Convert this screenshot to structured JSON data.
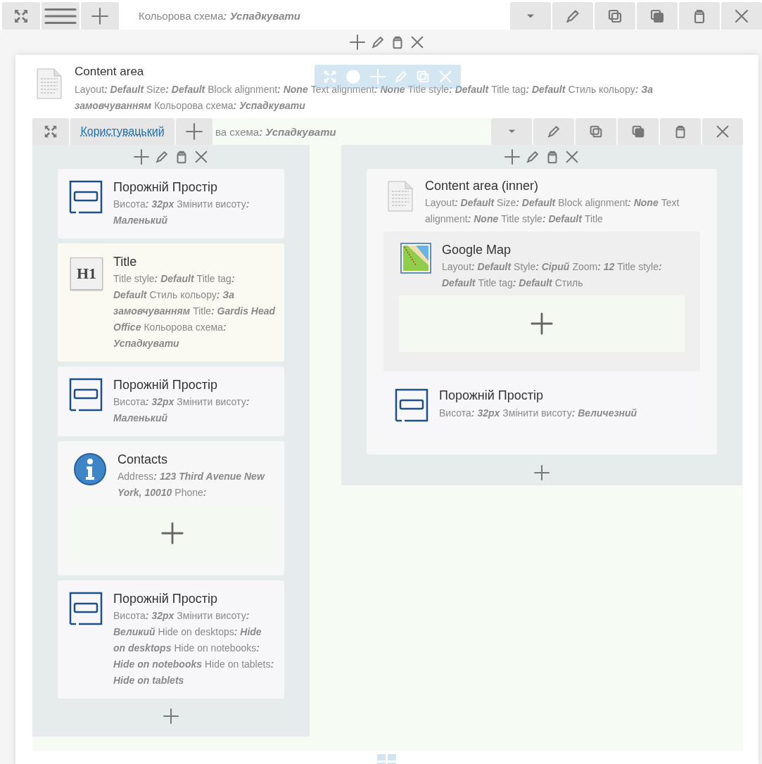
{
  "top_bar": {
    "scheme": {
      "label": "Кольорова схема",
      "value": ": Успадкувати"
    }
  },
  "content_area": {
    "title": "Content area",
    "meta": [
      {
        "label": "Layout",
        "value": ": Default"
      },
      {
        "label": "Size",
        "value": ": Default"
      },
      {
        "label": "Block alignment",
        "value": ": None"
      },
      {
        "label": "Text alignment",
        "value": ": None"
      },
      {
        "label": "Title style",
        "value": ": Default"
      },
      {
        "label": "Title tag",
        "value": ": Default"
      },
      {
        "label": "Стиль кольору",
        "value": ": За замовчуванням"
      },
      {
        "label": "Кольорова схема",
        "value": ": Успадкувати"
      }
    ],
    "row": {
      "tab": "Користувацький",
      "scheme": {
        "label": "ва схема",
        "value": ": Успадкувати"
      },
      "columns": [
        {
          "blocks": [
            {
              "kind": "spacer",
              "title": "Порожній Простір",
              "meta": [
                {
                  "label": "Висота",
                  "value": ": 32px"
                },
                {
                  "label": "Змінити висоту",
                  "value": ": Маленький"
                }
              ]
            },
            {
              "kind": "title",
              "icon_text": "H1",
              "title": "Title",
              "meta": [
                {
                  "label": "Title style",
                  "value": ": Default"
                },
                {
                  "label": "Title tag",
                  "value": ": Default"
                },
                {
                  "label": "Стиль кольору",
                  "value": ": За замовчуванням"
                },
                {
                  "label": "Title",
                  "value": ": Gardis Head Office"
                },
                {
                  "label": "Кольорова схема",
                  "value": ": Успадкувати"
                }
              ]
            },
            {
              "kind": "spacer",
              "title": "Порожній Простір",
              "meta": [
                {
                  "label": "Висота",
                  "value": ": 32px"
                },
                {
                  "label": "Змінити висоту",
                  "value": ": Маленький"
                }
              ]
            },
            {
              "kind": "contacts",
              "title": "Contacts",
              "meta": [
                {
                  "label": "Address",
                  "value": ": 123 Third Avenue New York, 10010"
                },
                {
                  "label": "Phone",
                  "value": ":"
                }
              ]
            },
            {
              "kind": "spacer",
              "title": "Порожній Простір",
              "meta": [
                {
                  "label": "Висота",
                  "value": ": 32px"
                },
                {
                  "label": "Змінити висоту",
                  "value": ": Великий"
                },
                {
                  "label": "Hide on desktops",
                  "value": ": Hide on desktops"
                },
                {
                  "label": "Hide on notebooks",
                  "value": ": Hide on notebooks"
                },
                {
                  "label": "Hide on tablets",
                  "value": ": Hide on tablets"
                }
              ]
            }
          ]
        },
        {
          "blocks": [
            {
              "kind": "content_area",
              "title": "Content area (inner)",
              "meta": [
                {
                  "label": "Layout",
                  "value": ": Default"
                },
                {
                  "label": "Size",
                  "value": ": Default"
                },
                {
                  "label": "Block alignment",
                  "value": ": None"
                },
                {
                  "label": "Text alignment",
                  "value": ": None"
                },
                {
                  "label": "Title style",
                  "value": ": Default"
                },
                {
                  "label": "Title"
                }
              ],
              "children": [
                {
                  "kind": "map",
                  "title": "Google Map",
                  "meta": [
                    {
                      "label": "Layout",
                      "value": ": Default"
                    },
                    {
                      "label": "Style",
                      "value": ": Сірий"
                    },
                    {
                      "label": "Zoom",
                      "value": ": 12"
                    },
                    {
                      "label": "Title style",
                      "value": ": Default"
                    },
                    {
                      "label": "Title tag",
                      "value": ": Default"
                    },
                    {
                      "label": "Стиль"
                    }
                  ]
                },
                {
                  "kind": "spacer",
                  "title": "Порожній Простір",
                  "meta": [
                    {
                      "label": "Висота",
                      "value": ": 32px"
                    },
                    {
                      "label": "Змінити висоту",
                      "value": ": Величезний"
                    }
                  ]
                }
              ]
            }
          ]
        }
      ]
    }
  }
}
